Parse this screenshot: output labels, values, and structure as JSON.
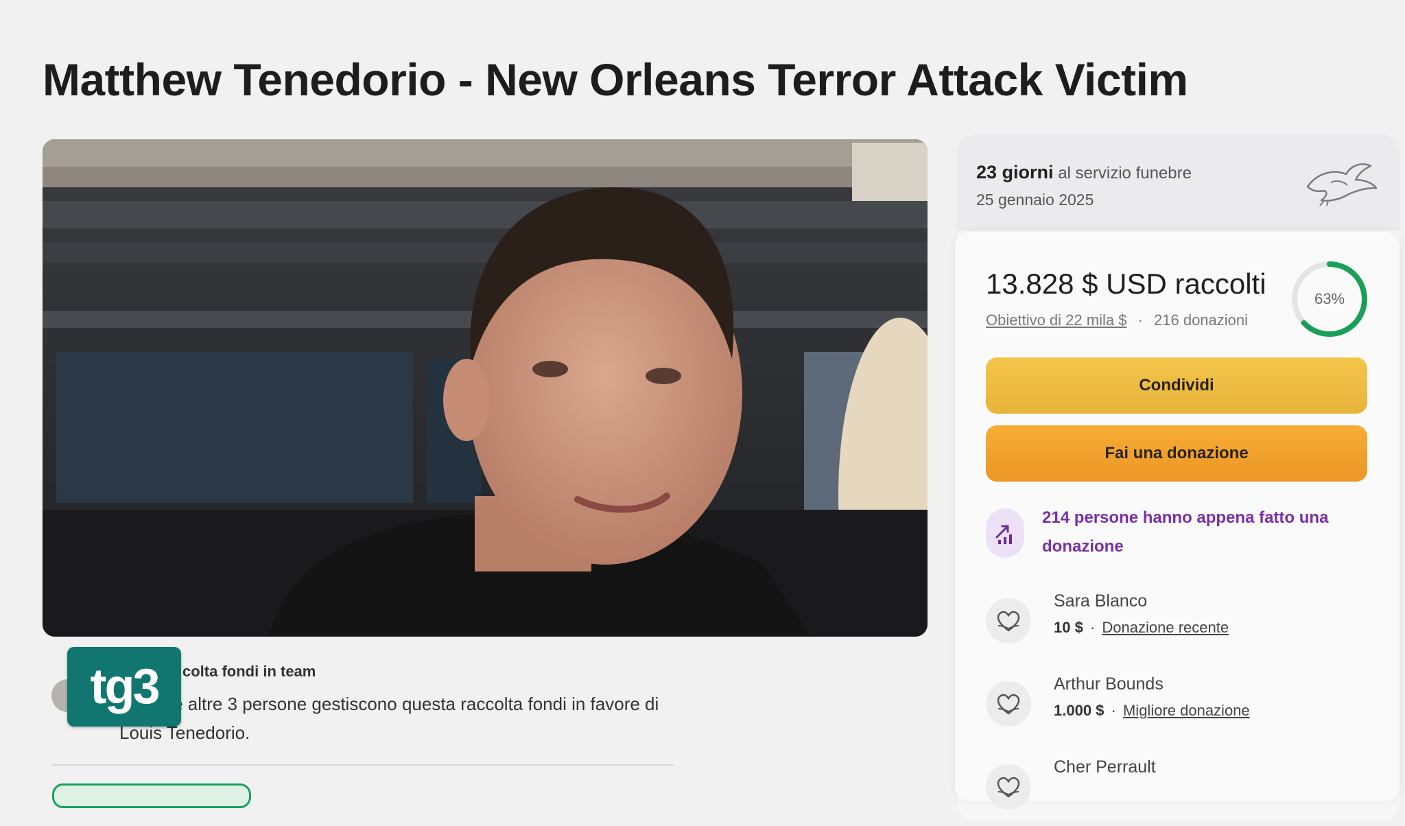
{
  "page": {
    "title": "Matthew Tenedorio - New Orleans Terror Attack Victim"
  },
  "organizer": {
    "label": "colta fondi in team",
    "description": "ounds e altre 3 persone gestiscono questa raccolta fondi in favore di Louis Tenedorio."
  },
  "overlay_logo": {
    "text": "tg3"
  },
  "funeral": {
    "days": "23 giorni",
    "days_suffix": "al servizio funebre",
    "date": "25 gennaio 2025",
    "icon": "dove-icon"
  },
  "fundraiser": {
    "raised": "13.828 $ USD raccolti",
    "goal_link": "Obiettivo di 22 mila $",
    "separator": "·",
    "donations": "216 donazioni",
    "progress_fraction": 0.63,
    "progress_label": "63%",
    "accent_color": "#1a9f58"
  },
  "buttons": {
    "share": "Condividi",
    "donate": "Fai una donazione"
  },
  "trend": {
    "icon": "trending-up-icon",
    "text": "214 persone hanno appena fatto una donazione",
    "color": "#7a2fa8"
  },
  "donors": [
    {
      "name": "Sara Blanco",
      "amount": "10 $",
      "sep": "·",
      "tag": "Donazione recente"
    },
    {
      "name": "Arthur Bounds",
      "amount": "1.000 $",
      "sep": "·",
      "tag": "Migliore donazione"
    },
    {
      "name": "Cher Perrault",
      "amount": "",
      "sep": "",
      "tag": ""
    }
  ]
}
